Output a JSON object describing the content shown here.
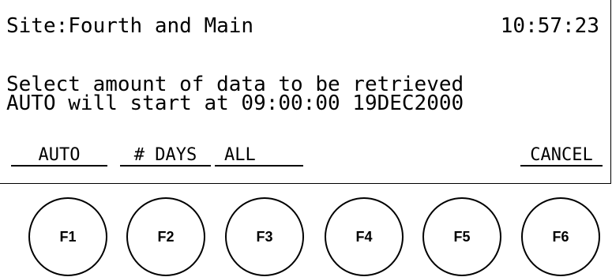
{
  "screen": {
    "site_line": "Site:Fourth and Main",
    "clock": "10:57:23",
    "message_line1": "Select amount of data to be retrieved",
    "message_line2": "AUTO will start at 09:00:00 19DEC2000"
  },
  "softkeys": {
    "auto": "AUTO",
    "days": "# DAYS",
    "all": "ALL",
    "cancel": "CANCEL"
  },
  "function_keys": [
    "F1",
    "F2",
    "F3",
    "F4",
    "F5",
    "F6"
  ]
}
